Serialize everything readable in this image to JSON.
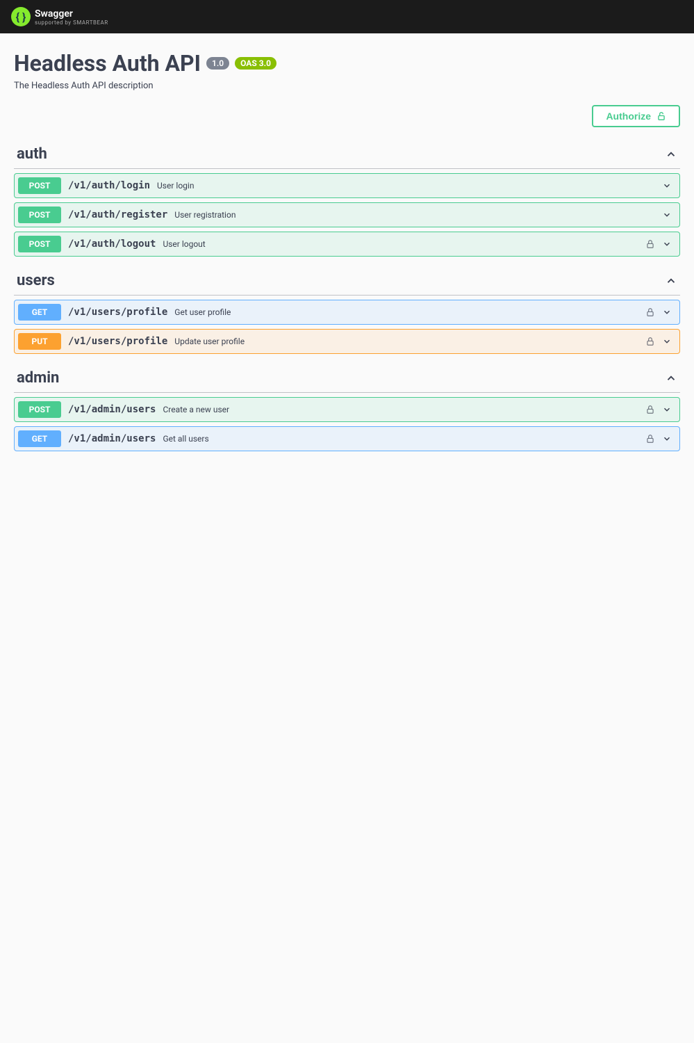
{
  "brand": {
    "name": "Swagger",
    "supported": "supported by SMARTBEAR"
  },
  "api": {
    "title": "Headless Auth API",
    "version": "1.0",
    "oas": "OAS 3.0",
    "description": "The Headless Auth API description"
  },
  "authorize_label": "Authorize",
  "tags": [
    {
      "name": "auth",
      "ops": [
        {
          "method": "POST",
          "path": "/v1/auth/login",
          "summary": "User login",
          "locked": false
        },
        {
          "method": "POST",
          "path": "/v1/auth/register",
          "summary": "User registration",
          "locked": false
        },
        {
          "method": "POST",
          "path": "/v1/auth/logout",
          "summary": "User logout",
          "locked": true
        }
      ]
    },
    {
      "name": "users",
      "ops": [
        {
          "method": "GET",
          "path": "/v1/users/profile",
          "summary": "Get user profile",
          "locked": true
        },
        {
          "method": "PUT",
          "path": "/v1/users/profile",
          "summary": "Update user profile",
          "locked": true
        }
      ]
    },
    {
      "name": "admin",
      "ops": [
        {
          "method": "POST",
          "path": "/v1/admin/users",
          "summary": "Create a new user",
          "locked": true
        },
        {
          "method": "GET",
          "path": "/v1/admin/users",
          "summary": "Get all users",
          "locked": true
        }
      ]
    }
  ]
}
